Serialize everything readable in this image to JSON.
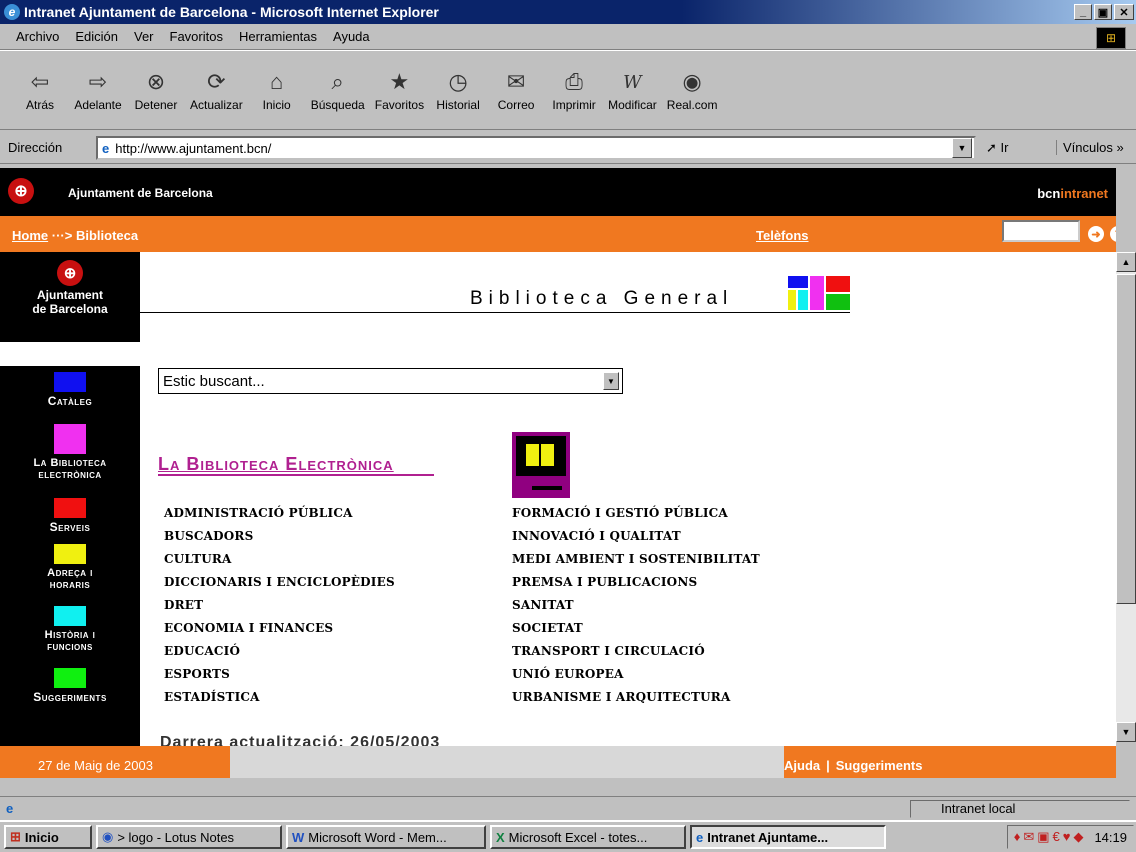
{
  "window": {
    "title": "Intranet Ajuntament de Barcelona - Microsoft Internet Explorer"
  },
  "menu": [
    "Archivo",
    "Edición",
    "Ver",
    "Favoritos",
    "Herramientas",
    "Ayuda"
  ],
  "toolbar": [
    {
      "label": "Atrás",
      "icon": "back-arrow-icon",
      "glyph": "⇦"
    },
    {
      "label": "Adelante",
      "icon": "forward-arrow-icon",
      "glyph": "⇨"
    },
    {
      "label": "Detener",
      "icon": "stop-icon",
      "glyph": "⊗"
    },
    {
      "label": "Actualizar",
      "icon": "refresh-icon",
      "glyph": "⟳"
    },
    {
      "label": "Inicio",
      "icon": "home-icon",
      "glyph": "⌂"
    },
    {
      "label": "Búsqueda",
      "icon": "search-icon",
      "glyph": "🔍"
    },
    {
      "label": "Favoritos",
      "icon": "favorites-icon",
      "glyph": "★"
    },
    {
      "label": "Historial",
      "icon": "history-icon",
      "glyph": "◷"
    },
    {
      "label": "Correo",
      "icon": "mail-icon",
      "glyph": "✉"
    },
    {
      "label": "Imprimir",
      "icon": "printer-icon",
      "glyph": "⎙"
    },
    {
      "label": "Modificar",
      "icon": "edit-icon",
      "glyph": "W"
    },
    {
      "label": "Real.com",
      "icon": "realcom-icon",
      "glyph": "◉"
    }
  ],
  "address": {
    "label": "Dirección",
    "value": "http://www.ajuntament.bcn/",
    "go": "Ir",
    "links": "Vínculos"
  },
  "header": {
    "name": "Ajuntament de Barcelona",
    "brand_a": "bcn",
    "brand_b": "intranet"
  },
  "crumb": {
    "home": "Home",
    "sep": "···>",
    "current": "Biblioteca",
    "phones": "Telèfons"
  },
  "sidebar": {
    "logo_line1": "Ajuntament",
    "logo_line2": "de Barcelona",
    "items": [
      {
        "label": "Catàleg",
        "color": "#1010f0"
      },
      {
        "label": "La Biblioteca electrònica",
        "color": "#f030f0"
      },
      {
        "label": "Serveis",
        "color": "#f01010"
      },
      {
        "label": "Adreça i horaris",
        "color": "#f0f010"
      },
      {
        "label": "Història i funcions",
        "color": "#10f0f0"
      },
      {
        "label": "Suggeriments",
        "color": "#10f010"
      }
    ]
  },
  "main": {
    "title": "Biblioteca General",
    "select_value": "Estic buscant...",
    "section": "La Biblioteca Electrònica",
    "col1": [
      "ADMINISTRACIÓ PÚBLICA",
      "BUSCADORS",
      "CULTURA",
      "DICCIONARIS I ENCICLOPÈDIES",
      "DRET",
      "ECONOMIA I FINANCES",
      "EDUCACIÓ",
      "ESPORTS",
      "ESTADÍSTICA"
    ],
    "col2": [
      "FORMACIÓ I GESTIÓ PÚBLICA",
      "INNOVACIÓ I QUALITAT",
      "MEDI AMBIENT I SOSTENIBILITAT",
      "PREMSA I PUBLICACIONS",
      "SANITAT",
      "SOCIETAT",
      "TRANSPORT I CIRCULACIÓ",
      "UNIÓ EUROPEA",
      "URBANISME I ARQUITECTURA"
    ],
    "updated": "Darrera actualització: 26/05/2003"
  },
  "footer": {
    "date": "27 de Maig de 2003",
    "help": "Ajuda",
    "suggestions": "Suggeriments"
  },
  "status": {
    "zone": "Intranet local"
  },
  "taskbar": {
    "start": "Inicio",
    "tasks": [
      "> logo - Lotus Notes",
      "Microsoft Word - Mem...",
      "Microsoft Excel - totes...",
      "Intranet Ajuntame..."
    ],
    "clock": "14:19"
  }
}
